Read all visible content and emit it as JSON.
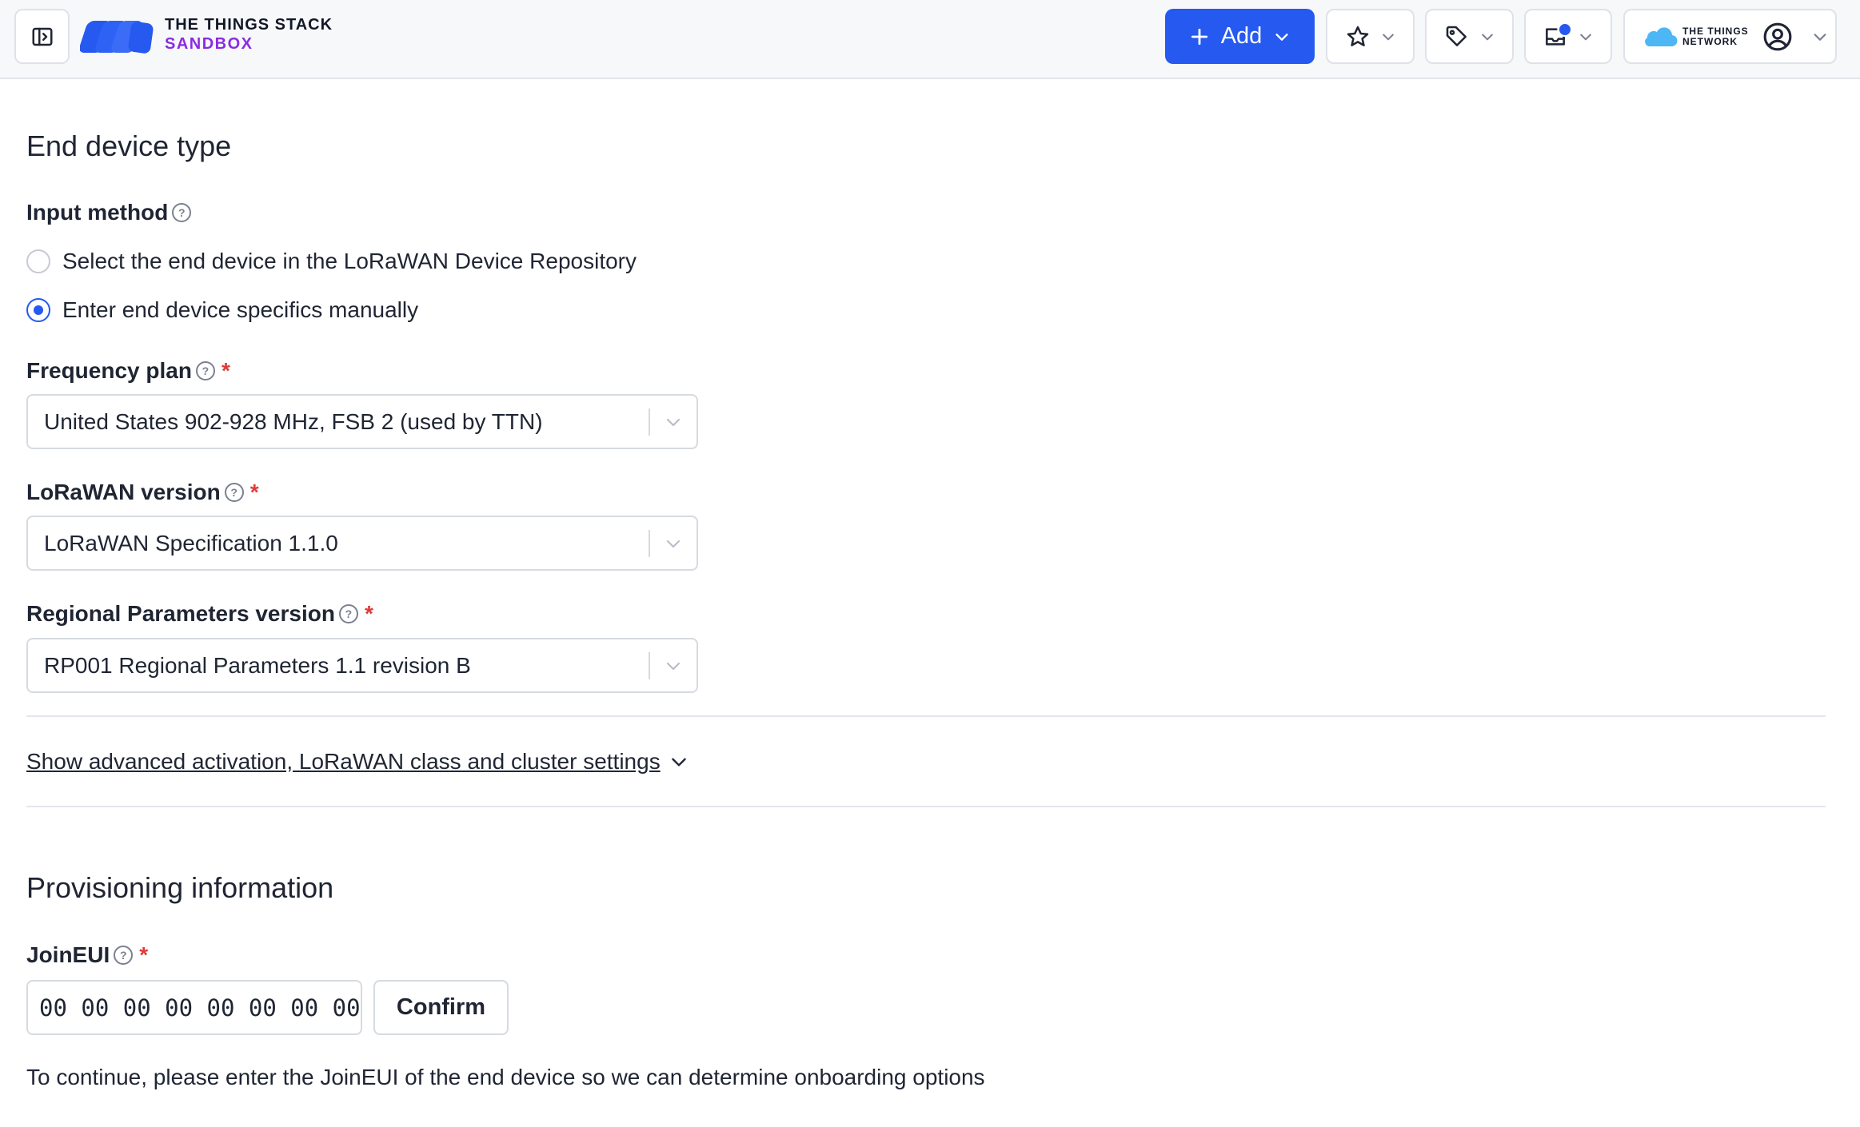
{
  "header": {
    "brand_line1": "THE THINGS STACK",
    "brand_line2": "SANDBOX",
    "add_label": "Add",
    "ttn_label_1": "THE THINGS",
    "ttn_label_2": "NETWORK",
    "icons": [
      "sidebar-toggle-icon",
      "star-icon",
      "tag-icon",
      "inbox-icon",
      "cloud-icon",
      "user-circle-icon",
      "chevron-down-icon"
    ],
    "accent_color": "#2559f0",
    "brand_secondary_color": "#8b2be2"
  },
  "end_device_type": {
    "title": "End device type",
    "input_method_label": "Input method",
    "options": [
      {
        "label": "Select the end device in the LoRaWAN Device Repository",
        "checked": false
      },
      {
        "label": "Enter end device specifics manually",
        "checked": true
      }
    ],
    "frequency_plan": {
      "label": "Frequency plan",
      "required": "*",
      "value": "United States 902-928 MHz, FSB 2 (used by TTN)"
    },
    "lorawan_version": {
      "label": "LoRaWAN version",
      "required": "*",
      "value": "LoRaWAN Specification 1.1.0"
    },
    "regional_parameters": {
      "label": "Regional Parameters version",
      "required": "*",
      "value": "RP001 Regional Parameters 1.1 revision B"
    },
    "advanced_link": "Show advanced activation, LoRaWAN class and cluster settings"
  },
  "provisioning": {
    "title": "Provisioning information",
    "join_eui_label": "JoinEUI",
    "required": "*",
    "join_eui_value": "00 00 00 00 00 00 00 00",
    "confirm_label": "Confirm",
    "hint": "To continue, please enter the JoinEUI of the end device so we can determine onboarding options"
  }
}
